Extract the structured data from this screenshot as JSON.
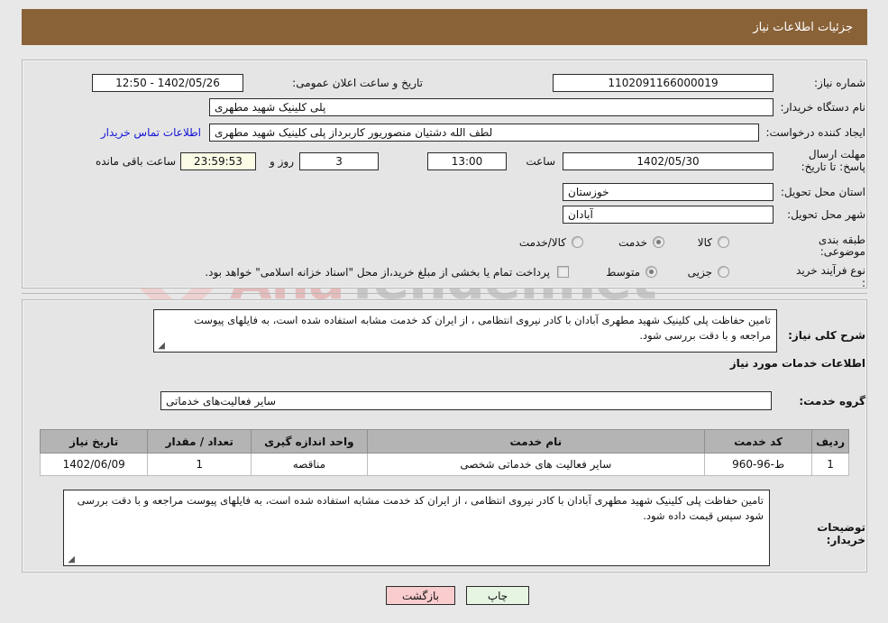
{
  "header": {
    "title": "جزئیات اطلاعات نیاز"
  },
  "main": {
    "need_number_label": "شماره نیاز:",
    "need_number_value": "1102091166000019",
    "announce_datetime_label": "تاریخ و ساعت اعلان عمومی:",
    "announce_datetime_value": "1402/05/26 - 12:50",
    "buyer_org_label": "نام دستگاه خریدار:",
    "buyer_org_value": "پلی کلینیک شهید مطهری",
    "request_creator_label": "ایجاد کننده درخواست:",
    "request_creator_value": "لطف الله دشتیان منصوریور کاربرداز پلی کلینیک شهید مطهری",
    "buyer_contact_link": "اطلاعات تماس خریدار",
    "deadline_label": "مهلت ارسال پاسخ: تا تاریخ:",
    "deadline_date_value": "1402/05/30",
    "hour_label": "ساعت",
    "deadline_hour_value": "13:00",
    "days_value": "3",
    "days_label": "روز و",
    "countdown_value": "23:59:53",
    "remaining_label": "ساعت باقی مانده",
    "province_label": "استان محل تحویل:",
    "province_value": "خوزستان",
    "city_label": "شهر محل تحویل:",
    "city_value": "آبادان",
    "category_label": "طبقه بندی موضوعی:",
    "category_options": [
      "کالا",
      "خدمت",
      "کالا/خدمت"
    ],
    "category_selected": "خدمت",
    "process_label": "نوع فرآیند خرید :",
    "process_options": [
      "جزیی",
      "متوسط"
    ],
    "process_selected": "متوسط",
    "treasury_checkbox_label": "پرداخت تمام یا بخشی از مبلغ خرید،از محل \"اسناد خزانه اسلامی\" خواهد بود.",
    "treasury_checked": false
  },
  "description": {
    "general_label": "شرح کلی نیاز:",
    "general_value": "تامین حفاظت پلی کلینیک شهید مطهری آبادان با کادر نیروی انتظامی ، از ایران کد خدمت مشابه استفاده شده است، به فایلهای پیوست مراجعه و با دقت بررسی شود.",
    "services_info_heading": "اطلاعات خدمات مورد نیاز",
    "service_group_label": "گروه خدمت:",
    "service_group_value": "سایر فعالیت‌های خدماتی",
    "buyer_notes_label": "توضیحات خریدار:",
    "buyer_notes_value": "تامین حفاظت پلی کلینیک شهید مطهری آبادان با کادر نیروی انتظامی ، از ایران کد خدمت مشابه استفاده شده است، به فایلهای پیوست مراجعه و با دقت بررسی شود سپس قیمت داده شود."
  },
  "table": {
    "columns": [
      "ردیف",
      "کد خدمت",
      "نام خدمت",
      "واحد اندازه گیری",
      "تعداد / مقدار",
      "تاریخ نیاز"
    ],
    "rows": [
      {
        "row_no": "1",
        "service_code": "ط-96-960",
        "service_name": "سایر فعالیت های خدماتی شخصی",
        "unit": "مناقصه",
        "quantity": "1",
        "need_date": "1402/06/09"
      }
    ]
  },
  "footer": {
    "back_label": "بازگشت",
    "print_label": "چاپ"
  },
  "watermark": {
    "text_left": "Ana",
    "text_right": "Tender.net"
  },
  "colors": {
    "header_bg": "#8a6238",
    "page_bg": "#e8e8e8",
    "panel_bg": "#e5e5e5",
    "link": "#1313d8",
    "back_btn": "#f9ccce",
    "print_btn": "#e6f5e2",
    "countdown_bg": "#fbfbe6",
    "table_header": "#b4b4b4"
  }
}
